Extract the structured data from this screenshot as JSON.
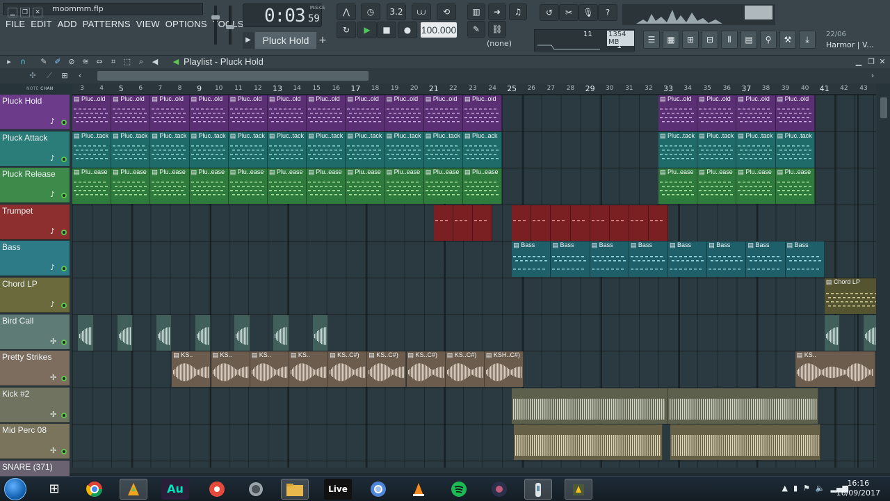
{
  "window": {
    "project_name": "moommm.flp",
    "close": "✕",
    "restore": "❐",
    "minimize": "▁"
  },
  "menu": [
    "FILE",
    "EDIT",
    "ADD",
    "PATTERNS",
    "VIEW",
    "OPTIONS",
    "TOOLS",
    "?"
  ],
  "transport": {
    "time_main": "0:03",
    "time_sub": "59",
    "time_label": "M:S:CS",
    "pattern": "Pluck Hold",
    "tempo": "100.000",
    "play_label": "▶",
    "stop_label": "■",
    "record_label": "●",
    "snap": "(none)",
    "snap_value": "3.2"
  },
  "cpu": {
    "voices": "11",
    "memory": "1354 MB",
    "polyphony": "1"
  },
  "hint": {
    "date": "22/06",
    "plugin": "Harmor | V..."
  },
  "playlist": {
    "title": "Playlist - Pluck Hold",
    "note_label": "NOTE",
    "chan_label": "CHAN",
    "ruler": [
      "3",
      "4",
      "5",
      "6",
      "7",
      "8",
      "9",
      "10",
      "11",
      "12",
      "13",
      "14",
      "15",
      "16",
      "17",
      "18",
      "19",
      "20",
      "21",
      "22",
      "23",
      "24",
      "25",
      "26",
      "27",
      "28",
      "29",
      "30",
      "31",
      "32",
      "33",
      "34",
      "35",
      "36",
      "37",
      "38",
      "39",
      "40",
      "41",
      "42",
      "43"
    ],
    "tracks": [
      {
        "name": "Pluck Hold",
        "color": "#6c3b8a",
        "icon": "♪"
      },
      {
        "name": "Pluck Attack",
        "color": "#2b7d7a",
        "icon": "♪"
      },
      {
        "name": "Pluck Release",
        "color": "#3d8a4a",
        "icon": "♪"
      },
      {
        "name": "Trumpet",
        "color": "#8e2f2f",
        "icon": "♪"
      },
      {
        "name": "Bass",
        "color": "#2c7b86",
        "icon": "♪"
      },
      {
        "name": "Chord LP",
        "color": "#6a6a3c",
        "icon": "♪"
      },
      {
        "name": "Bird Call",
        "color": "#5e7b76",
        "icon": "✢"
      },
      {
        "name": "Pretty Strikes",
        "color": "#7d6d5f",
        "icon": "✢"
      },
      {
        "name": "Kick #2",
        "color": "#6f7360",
        "icon": "✢"
      },
      {
        "name": "Mid Perc 08",
        "color": "#7a745c",
        "icon": "✢"
      },
      {
        "name": "SNARE (371)",
        "color": "#6a6270",
        "icon": "✢"
      }
    ],
    "clip_labels": {
      "pluck_hold": "Pluc..old",
      "pluck_hold_last": "Pluc..old",
      "pluck_attack": "Pluc..tack",
      "pluck_attack_alt": "Pluc..ack",
      "pluck_release": "Plu..ease",
      "bass": "Bass",
      "chord": "Chord LP",
      "ks": "KS..",
      "ks_c": "KS..C#)",
      "ksh_c": "KSH..C#)"
    }
  },
  "taskbar": {
    "time": "16:16",
    "date": "16/09/2017",
    "apps": [
      "windows",
      "chrome",
      "fl-studio",
      "audition",
      "app-red",
      "app-gray",
      "explorer",
      "live",
      "chrome-alt",
      "vlc",
      "spotify",
      "app-dark",
      "app-media",
      "app-fl-alt"
    ],
    "live_label": "Live",
    "au_label": "Au"
  }
}
